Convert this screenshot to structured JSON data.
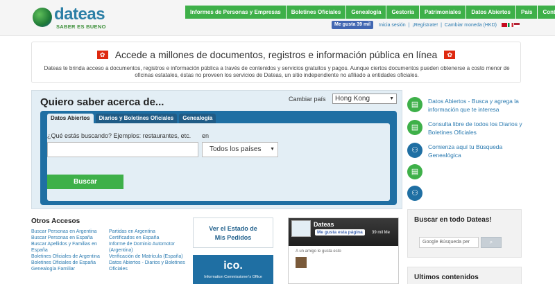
{
  "logo": {
    "word": "dateas",
    "tagline": "SABER ES BUENO"
  },
  "topnav": [
    "Informes de Personas y Empresas",
    "Boletines Oficiales",
    "Genealogía",
    "Gestoría",
    "Patrimoniales",
    "Datos Abiertos",
    "País",
    "Contacto"
  ],
  "subbar": {
    "fb_like": "Me gusta 39 mil",
    "links": [
      "Inicia sesión",
      "¡Regístrate!",
      "Cambiar moneda (HKD)"
    ]
  },
  "banner": {
    "headline": "Accede a millones de documentos, registros e información pública en línea",
    "description": "Dateas te brinda acceso a documentos, registros e información pública a través de contenidos y servicios gratuitos y pagos. Aunque ciertos documentos pueden obtenerse a costo menor de oficinas estatales, éstas no proveen los servicios de Dateas, un sitio independiente no afiliado a entidades oficiales."
  },
  "search_panel": {
    "title": "Quiero saber acerca de...",
    "country_label": "Cambiar país",
    "country_value": "Hong Kong",
    "tabs": [
      "Datos Abiertos",
      "Diarios y Boletines Oficiales",
      "Genealogía"
    ],
    "query_label": "¿Qué estás buscando? Ejemplos: restaurantes, etc.",
    "in_label": "en",
    "scope_value": "Todos los países",
    "button": "Buscar"
  },
  "info_list": [
    "Datos Abiertos - Busca y agrega la información que te interesa",
    "Consulta libre de todos los Diarios y Boletines Oficiales",
    "Comienza aquí tu Búsqueda Genealógica"
  ],
  "otros": {
    "title": "Otros Accesos",
    "col1": [
      "Buscar Personas en Argentina",
      "Buscar Personas en España",
      "Buscar Apellidos y Familias en",
      "España",
      "Boletines Oficiales de Argentina",
      "Boletines Oficiales de España",
      "Genealogía Familiar"
    ],
    "col2": [
      "Partidas en Argentina",
      "Certificados en España",
      "Informe de Dominio Automotor",
      "(Argentina)",
      "Verificación de Matrícula (España)",
      "Datos Abiertos - Diarios y Boletines",
      "Oficiales"
    ]
  },
  "estado": {
    "line1": "Ver el Estado de",
    "line2": "Mis Pedidos"
  },
  "ico": {
    "mark": "ico.",
    "sub": "Information Commissioner's Office"
  },
  "fb_widget": {
    "name": "Dateas",
    "button": "Me gusta esta página",
    "count": "39 mil Me",
    "friend": "A un amigo le gusta esto"
  },
  "search_all": {
    "title": "Buscar en todo Dateas!",
    "placeholder": "Google Búsqueda per"
  },
  "ultimos": {
    "title": "Ultimos contenidos"
  },
  "colors": {
    "green": "#3eb049",
    "blue": "#1f6fa3",
    "link": "#2a7ab0"
  }
}
